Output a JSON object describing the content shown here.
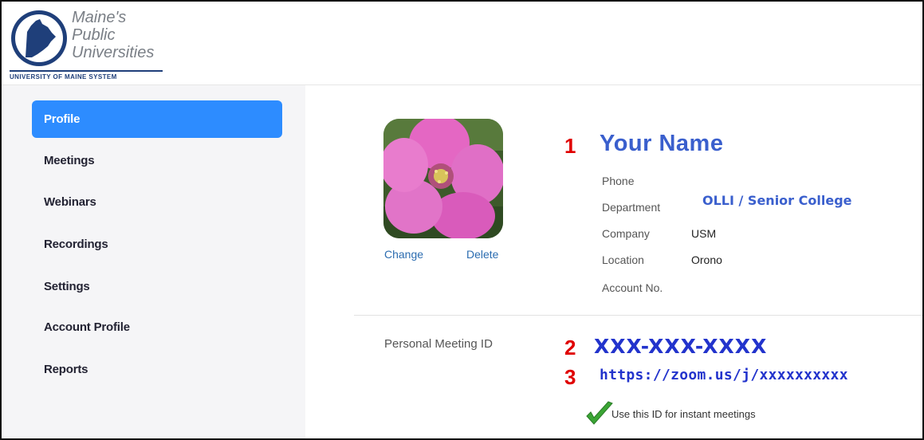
{
  "logo": {
    "line1": "Maine's",
    "line2": "Public",
    "line3": "Universities",
    "system": "UNIVERSITY OF MAINE SYSTEM"
  },
  "sidebar": {
    "items": [
      {
        "label": "Profile",
        "active": true
      },
      {
        "label": "Meetings"
      },
      {
        "label": "Webinars"
      },
      {
        "label": "Recordings"
      },
      {
        "label": "Settings"
      },
      {
        "label": "Account Profile"
      },
      {
        "label": "Reports"
      }
    ]
  },
  "profile": {
    "photo": {
      "change": "Change",
      "delete": "Delete"
    },
    "markers": {
      "one": "1",
      "two": "2",
      "three": "3"
    },
    "name": "Your Name",
    "fields": {
      "phone_label": "Phone",
      "department_label": "Department",
      "department_value": "OLLI / Senior College",
      "company_label": "Company",
      "company_value": "USM",
      "location_label": "Location",
      "location_value": "Orono",
      "account_label": "Account No."
    },
    "pmi": {
      "label": "Personal Meeting ID",
      "id": "XXX-XXX-XXXX",
      "url": "https://zoom.us/j/xxxxxxxxxx",
      "instant_text": "Use this ID for instant meetings"
    }
  },
  "colors": {
    "accent": "#2d8cff",
    "marker": "#e00000",
    "highlight_text": "#2233cc"
  }
}
